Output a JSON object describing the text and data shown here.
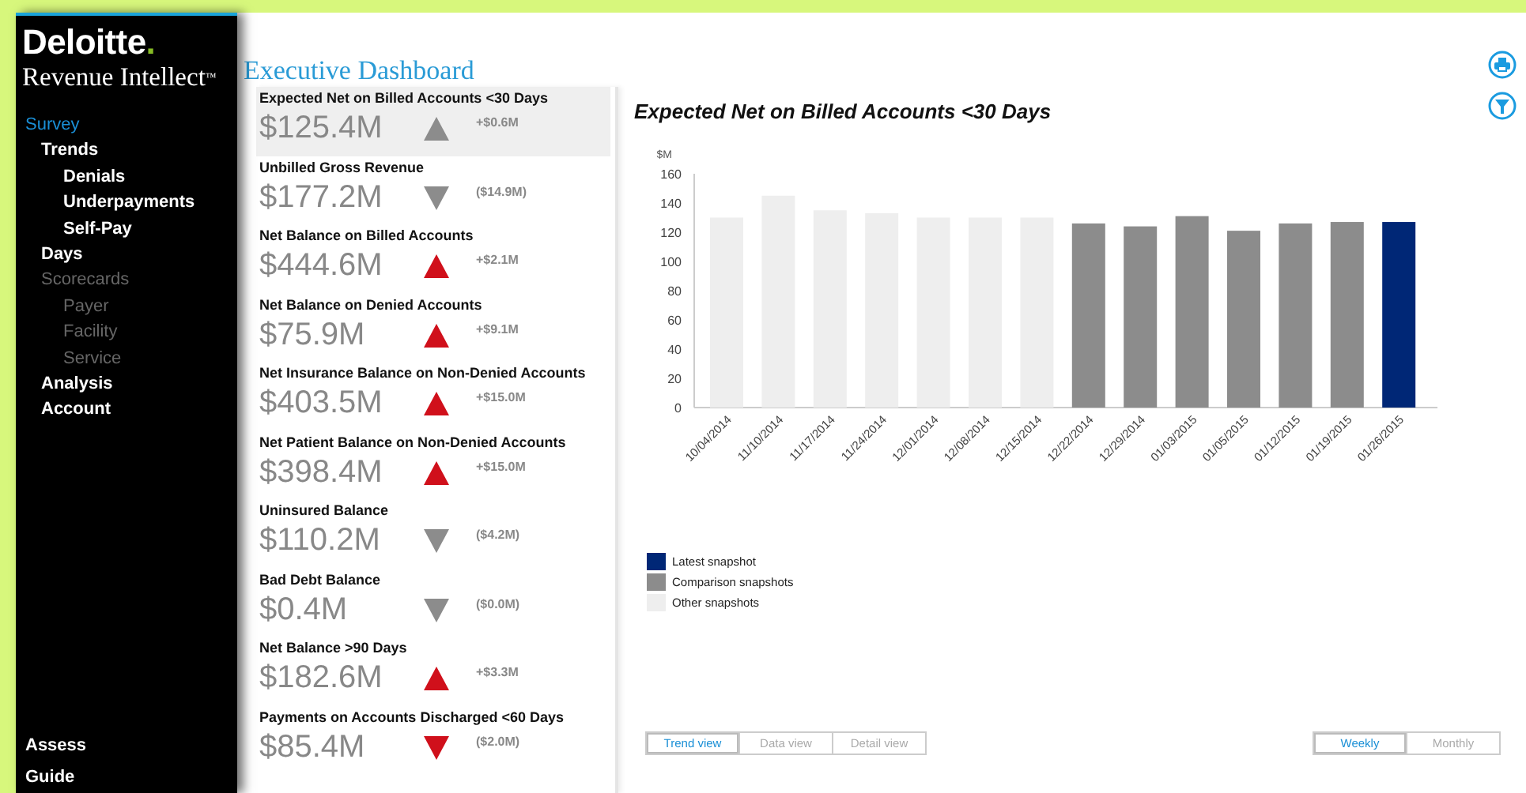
{
  "brand": {
    "name": "Deloitte",
    "dot": ".",
    "product": "Revenue Intellect",
    "mark": "™"
  },
  "nav": [
    {
      "label": "Survey",
      "selected": true,
      "disabled": false,
      "children": [
        {
          "label": "Trends",
          "selected": false,
          "disabled": false,
          "children": [
            {
              "label": "Denials",
              "selected": false,
              "disabled": false
            },
            {
              "label": "Underpayments",
              "selected": false,
              "disabled": false
            },
            {
              "label": "Self-Pay",
              "selected": false,
              "disabled": false
            }
          ]
        },
        {
          "label": "Days",
          "selected": false,
          "disabled": false
        },
        {
          "label": "Scorecards",
          "selected": false,
          "disabled": true,
          "children": [
            {
              "label": "Payer",
              "selected": false,
              "disabled": true
            },
            {
              "label": "Facility",
              "selected": false,
              "disabled": true
            },
            {
              "label": "Service",
              "selected": false,
              "disabled": true
            }
          ]
        },
        {
          "label": "Analysis",
          "selected": false,
          "disabled": false
        },
        {
          "label": "Account",
          "selected": false,
          "disabled": false
        }
      ]
    }
  ],
  "nav_bottom": [
    {
      "label": "Assess"
    },
    {
      "label": "Guide"
    }
  ],
  "page_title": "Executive Dashboard",
  "metrics": [
    {
      "label": "Expected Net on Billed Accounts <30 Days",
      "value": "$125.4M",
      "change": "+$0.6M",
      "kind": "up",
      "color": "#8c8c8c",
      "selected": true
    },
    {
      "label": "Unbilled Gross Revenue",
      "value": "$177.2M",
      "change": "($14.9M)",
      "kind": "down",
      "color": "#8c8c8c",
      "selected": false
    },
    {
      "label": "Net Balance on Billed Accounts",
      "value": "$444.6M",
      "change": "+$2.1M",
      "kind": "up",
      "color": "#d0101b",
      "selected": false
    },
    {
      "label": "Net Balance on Denied Accounts",
      "value": "$75.9M",
      "change": "+$9.1M",
      "kind": "up",
      "color": "#d0101b",
      "selected": false
    },
    {
      "label": "Net Insurance Balance on Non-Denied Accounts",
      "value": "$403.5M",
      "change": "+$15.0M",
      "kind": "up",
      "color": "#d0101b",
      "selected": false
    },
    {
      "label": "Net Patient Balance on Non-Denied Accounts",
      "value": "$398.4M",
      "change": "+$15.0M",
      "kind": "up",
      "color": "#d0101b",
      "selected": false
    },
    {
      "label": "Uninsured Balance",
      "value": "$110.2M",
      "change": "($4.2M)",
      "kind": "down",
      "color": "#8c8c8c",
      "selected": false
    },
    {
      "label": "Bad Debt Balance",
      "value": "$0.4M",
      "change": "($0.0M)",
      "kind": "down",
      "color": "#8c8c8c",
      "selected": false
    },
    {
      "label": "Net Balance >90 Days",
      "value": "$182.6M",
      "change": "+$3.3M",
      "kind": "up",
      "color": "#d0101b",
      "selected": false
    },
    {
      "label": "Payments on Accounts Discharged <60 Days",
      "value": "$85.4M",
      "change": "($2.0M)",
      "kind": "down",
      "color": "#d0101b",
      "selected": false
    }
  ],
  "chart": {
    "chart_data": {
      "type": "bar",
      "title": "Expected Net on Billed Accounts <30 Days",
      "ylabel": "$M",
      "stacked": true,
      "ylim": [
        0,
        160
      ],
      "yticks": [
        0,
        20,
        40,
        60,
        80,
        100,
        120,
        140,
        160
      ],
      "categories": [
        "10/04/2014",
        "11/10/2014",
        "11/17/2014",
        "11/24/2014",
        "12/01/2014",
        "12/08/2014",
        "12/15/2014",
        "12/22/2014",
        "12/29/2014",
        "01/03/2015",
        "01/05/2015",
        "01/12/2015",
        "01/19/2015",
        "01/26/2015"
      ],
      "series": [
        {
          "name": "Latest snapshot",
          "color": "#002776",
          "values": [
            null,
            null,
            null,
            null,
            null,
            null,
            null,
            null,
            null,
            null,
            null,
            null,
            null,
            127
          ]
        },
        {
          "name": "Comparison snapshots",
          "color": "#8c8c8c",
          "values": [
            null,
            null,
            null,
            null,
            null,
            null,
            null,
            126,
            124,
            131,
            121,
            126,
            127,
            null
          ]
        },
        {
          "name": "Other snapshots",
          "color": "#eeeeee",
          "values": [
            130,
            145,
            135,
            133,
            130,
            130,
            130,
            null,
            null,
            null,
            null,
            null,
            null,
            null
          ]
        }
      ]
    }
  },
  "view_tabs": [
    {
      "label": "Trend view",
      "selected": true
    },
    {
      "label": "Data view",
      "selected": false
    },
    {
      "label": "Detail view",
      "selected": false
    }
  ],
  "period_tabs": [
    {
      "label": "Weekly",
      "selected": true
    },
    {
      "label": "Monthly",
      "selected": false
    }
  ]
}
